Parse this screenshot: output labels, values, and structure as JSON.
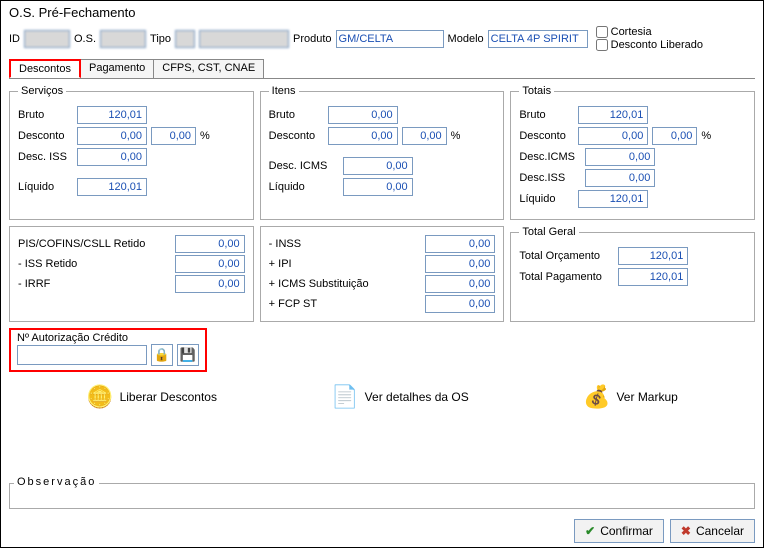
{
  "title": "O.S. Pré-Fechamento",
  "header": {
    "id_label": "ID",
    "os_label": "O.S.",
    "tipo_label": "Tipo",
    "produto_label": "Produto",
    "produto_value": "GM/CELTA",
    "modelo_label": "Modelo",
    "modelo_value": "CELTA 4P SPIRIT",
    "cortesia_label": "Cortesia",
    "desconto_liberado_label": "Desconto Liberado"
  },
  "tabs": {
    "descontos": "Descontos",
    "pagamento": "Pagamento",
    "cfps": "CFPS, CST, CNAE"
  },
  "servicos": {
    "legend": "Serviços",
    "bruto_label": "Bruto",
    "bruto": "120,01",
    "desconto_label": "Desconto",
    "desconto": "0,00",
    "desconto_pct": "0,00",
    "desc_iss_label": "Desc. ISS",
    "desc_iss": "0,00",
    "liquido_label": "Líquido",
    "liquido": "120,01"
  },
  "itens": {
    "legend": "Itens",
    "bruto_label": "Bruto",
    "bruto": "0,00",
    "desconto_label": "Desconto",
    "desconto": "0,00",
    "desconto_pct": "0,00",
    "desc_icms_label": "Desc. ICMS",
    "desc_icms": "0,00",
    "liquido_label": "Líquido",
    "liquido": "0,00"
  },
  "totais": {
    "legend": "Totais",
    "bruto_label": "Bruto",
    "bruto": "120,01",
    "desconto_label": "Desconto",
    "desconto": "0,00",
    "desconto_pct": "0,00",
    "desc_icms_label": "Desc.ICMS",
    "desc_icms": "0,00",
    "desc_iss_label": "Desc.ISS",
    "desc_iss": "0,00",
    "liquido_label": "Líquido",
    "liquido": "120,01"
  },
  "tax_left": {
    "pis_label": "PIS/COFINS/CSLL Retido",
    "pis": "0,00",
    "iss_retido_label": "- ISS Retido",
    "iss_retido": "0,00",
    "irrf_label": "- IRRF",
    "irrf": "0,00"
  },
  "tax_right": {
    "inss_label": "- INSS",
    "inss": "0,00",
    "ipi_label": "+ IPI",
    "ipi": "0,00",
    "icms_st_label": "+ ICMS Substituição",
    "icms_st": "0,00",
    "fcp_st_label": "+ FCP ST",
    "fcp_st": "0,00"
  },
  "total_geral": {
    "legend": "Total Geral",
    "orcamento_label": "Total Orçamento",
    "orcamento": "120,01",
    "pagamento_label": "Total Pagamento",
    "pagamento": "120,01"
  },
  "auth": {
    "label": "Nº Autorização Crédito"
  },
  "actions": {
    "liberar": "Liberar Descontos",
    "detalhes": "Ver detalhes da OS",
    "markup": "Ver Markup"
  },
  "obs_label": "Observação",
  "buttons": {
    "confirmar": "Confirmar",
    "cancelar": "Cancelar"
  },
  "pct_symbol": "%"
}
